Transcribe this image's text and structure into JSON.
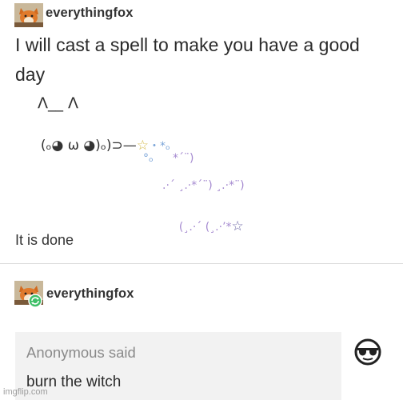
{
  "post": {
    "username": "everythingfox",
    "text": "I will cast a spell to make you have a good day",
    "spell": {
      "line1": "Λ__ Λ",
      "line2_face": "(ₒ◕ ω ◕)ₒ)⊃—",
      "line2_star": "☆",
      "line2_tail": "・*ₒ",
      "sparkle_a": "°ₒ",
      "sparkle_b": "*´¨)",
      "sparkle_c": ".·´ ¸.·*´¨) ¸.·*¨)",
      "sparkle_d": "(¸.·´ (¸.·’*",
      "sparkle_d_star": "☆"
    },
    "closing": "It is done"
  },
  "reblog": {
    "username": "everythingfox"
  },
  "ask": {
    "asker": "Anonymous",
    "said": "said",
    "message": "burn the witch"
  },
  "watermark": "imgflip.com",
  "colors": {
    "star_yellow": "#d4b94a",
    "sparkle_purple": "#a58ad0",
    "sparkle_blue": "#7aa4d8",
    "reblog_green": "#3fbf68"
  }
}
